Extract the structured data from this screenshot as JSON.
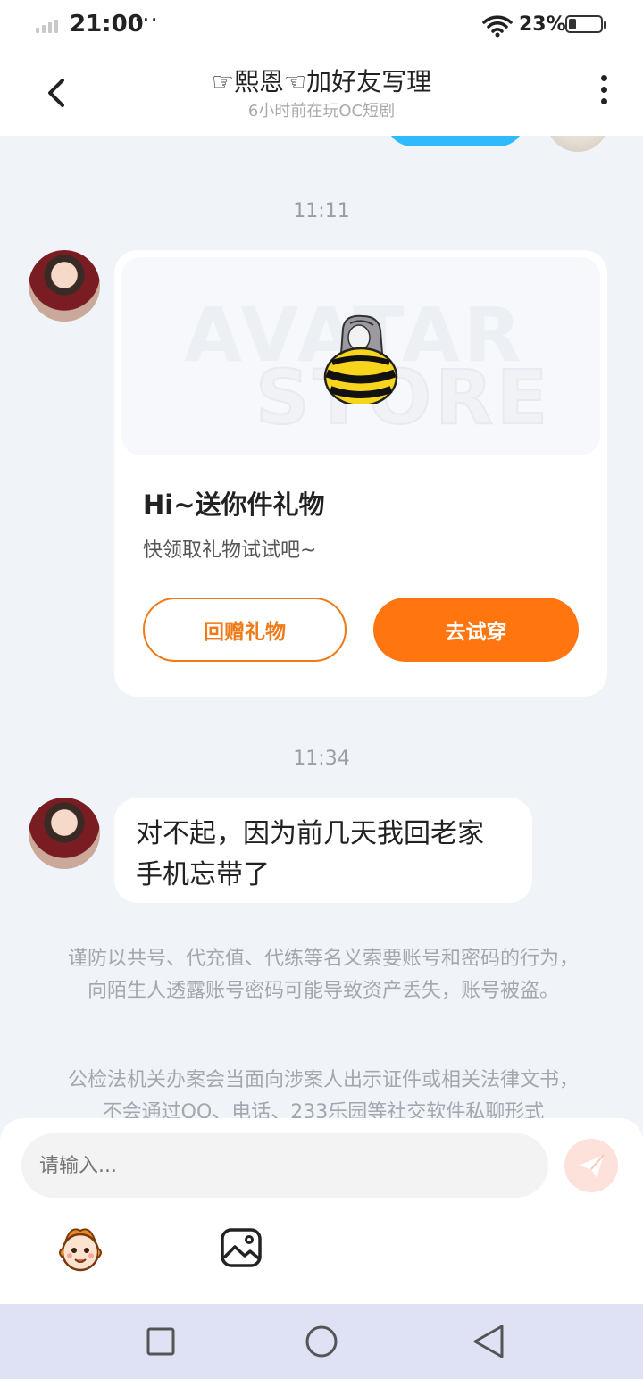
{
  "status_bar": {
    "time": "21:00",
    "more": "···",
    "battery": "23%",
    "battery_level": 0.23
  },
  "header": {
    "title": "☞熙恩☜加好友写理",
    "subtitle": "6小时前在玩OC短剧"
  },
  "messages": [
    {
      "time": "11:11",
      "type": "gift_card",
      "watermark_line1": "AVATAR",
      "watermark_line2": "STORE",
      "card_title": "Hi~送你件礼物",
      "card_subtitle": "快领取礼物试试吧~",
      "button_return": "回赠礼物",
      "button_try": "去试穿"
    },
    {
      "time": "11:34",
      "type": "text",
      "line1": "对不起，因为前几天我回老家",
      "line2": "手机忘带了"
    }
  ],
  "notices": {
    "first": "谨防以共号、代充值、代练等名义索要账号和密码的行为，向陌生人透露账号密码可能导致资产丢失，账号被盗。",
    "second": "公检法机关办案会当面向涉案人出示证件或相关法律文书，不会通过QQ、电话、233乐园等社交软件私聊形式"
  },
  "input": {
    "placeholder": "请输入..."
  },
  "colors": {
    "accent_orange": "#ff7510",
    "outline_orange": "#f07a17",
    "bubble_blue": "#30b9fb",
    "page_bg": "#f0f3f8",
    "nav_bg": "#dfe2f5"
  },
  "icons": [
    "back-arrow-icon",
    "more-vertical-icon",
    "wifi-icon",
    "battery-icon",
    "send-icon",
    "emoji-mascot-icon",
    "image-icon",
    "nav-square-icon",
    "nav-circle-icon",
    "nav-back-triangle-icon"
  ]
}
